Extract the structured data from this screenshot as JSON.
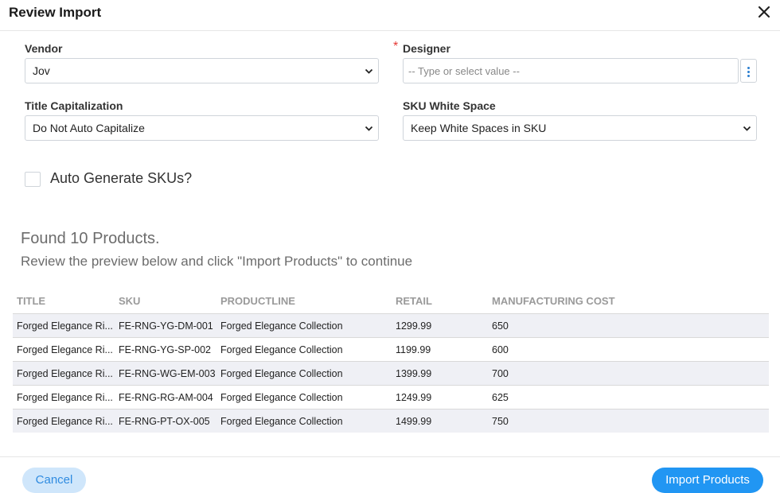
{
  "dialog": {
    "title": "Review Import",
    "close_icon": "close-icon"
  },
  "form": {
    "vendor": {
      "label": "Vendor",
      "value": "Jov"
    },
    "designer": {
      "label": "Designer",
      "required_mark": "*",
      "placeholder": "-- Type or select value --",
      "menu_icon": "kebab-icon"
    },
    "title_capitalization": {
      "label": "Title Capitalization",
      "value": "Do Not Auto Capitalize"
    },
    "sku_white_space": {
      "label": "SKU White Space",
      "value": "Keep White Spaces in SKU"
    },
    "auto_generate": {
      "label": "Auto Generate SKUs?",
      "checked": false
    }
  },
  "summary": {
    "found": "Found 10 Products.",
    "instructions": "Review the preview below and click \"Import Products\" to continue"
  },
  "table": {
    "headers": [
      "TITLE",
      "SKU",
      "PRODUCTLINE",
      "RETAIL",
      "MANUFACTURING COST"
    ],
    "rows": [
      [
        "Forged Elegance Ri...",
        "FE-RNG-YG-DM-001",
        "Forged Elegance Collection",
        "1299.99",
        "650"
      ],
      [
        "Forged Elegance Ri...",
        "FE-RNG-YG-SP-002",
        "Forged Elegance Collection",
        "1199.99",
        "600"
      ],
      [
        "Forged Elegance Ri...",
        "FE-RNG-WG-EM-003",
        "Forged Elegance Collection",
        "1399.99",
        "700"
      ],
      [
        "Forged Elegance Ri...",
        "FE-RNG-RG-AM-004",
        "Forged Elegance Collection",
        "1249.99",
        "625"
      ],
      [
        "Forged Elegance Ri...",
        "FE-RNG-PT-OX-005",
        "Forged Elegance Collection",
        "1499.99",
        "750"
      ]
    ]
  },
  "footer": {
    "cancel_label": "Cancel",
    "import_label": "Import Products"
  },
  "colors": {
    "primary": "#2196f3",
    "cancel_bg": "#cfe6fb",
    "required": "#e53935",
    "row_alt": "#eff0f5"
  }
}
